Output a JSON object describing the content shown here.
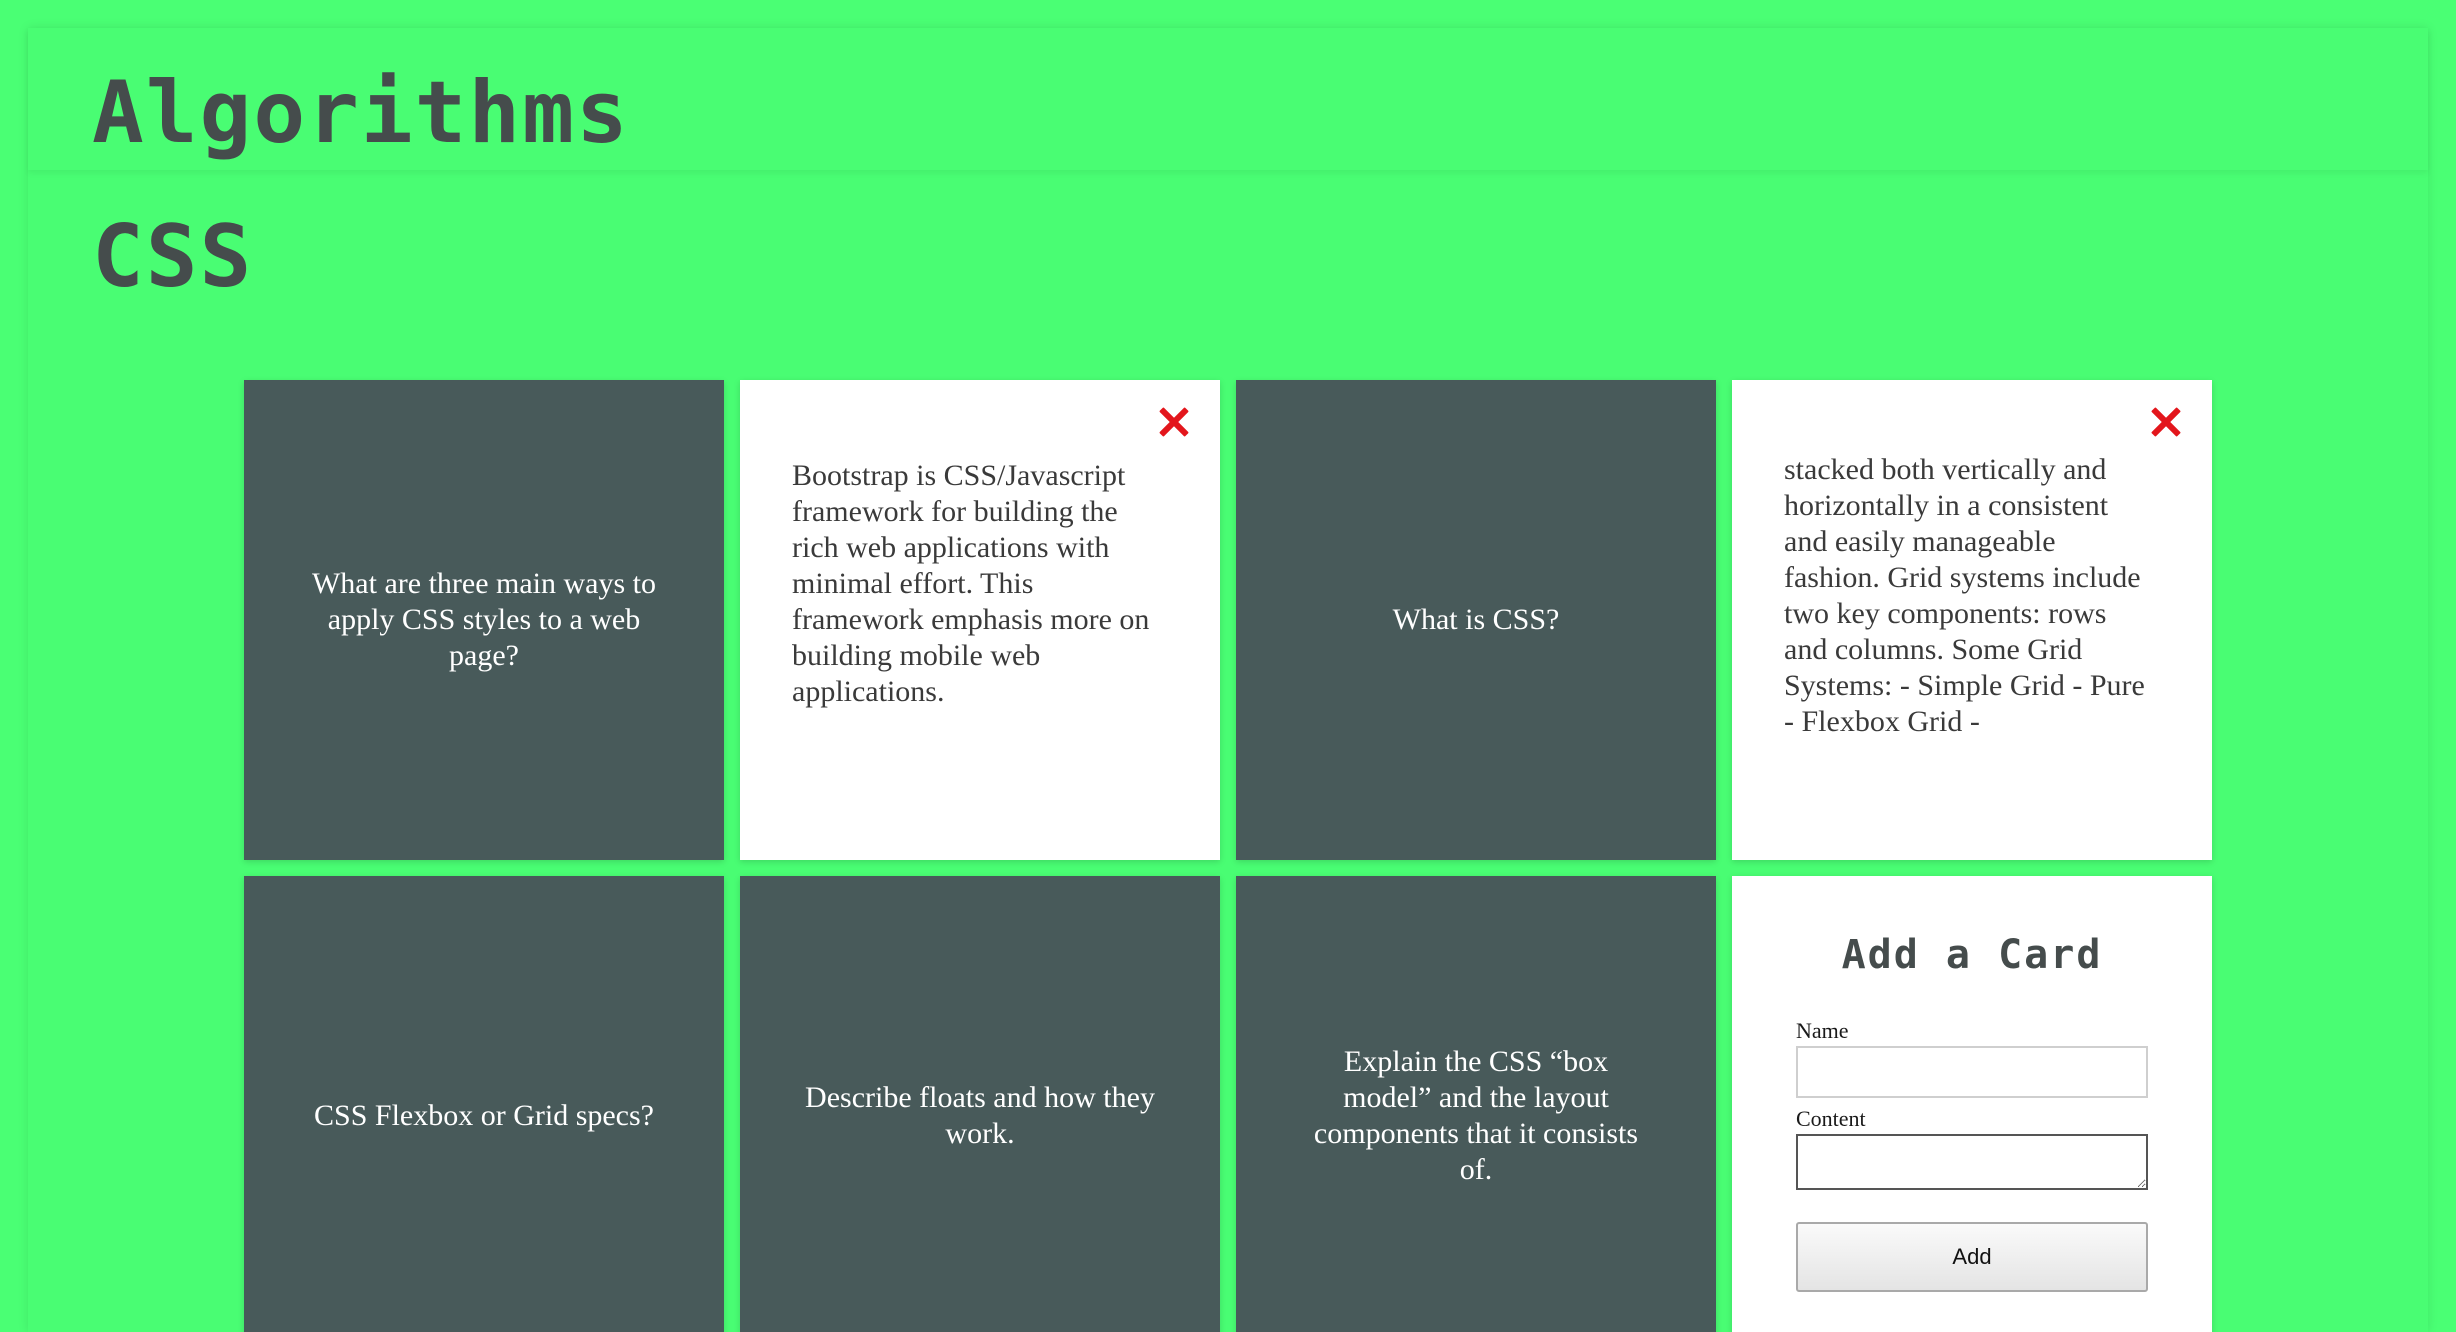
{
  "header": {
    "title": "Algorithms"
  },
  "section": {
    "title": "CSS"
  },
  "cards": [
    {
      "side": "front",
      "text": "What are three main ways to apply CSS styles to a web page?"
    },
    {
      "side": "back",
      "text": "Bootstrap is CSS/Javascript framework for building the rich web applications with minimal effort. This framework emphasis more on building mobile web applications."
    },
    {
      "side": "front",
      "text": "What is CSS?"
    },
    {
      "side": "back",
      "text": "stacked both vertically and horizontally in a consistent and easily manageable fashion. Grid systems include two key components: rows and columns. Some Grid Systems: - Simple Grid - Pure - Flexbox Grid -"
    },
    {
      "side": "front",
      "text": "CSS Flexbox or Grid specs?"
    },
    {
      "side": "front",
      "text": "Describe floats and how they work."
    },
    {
      "side": "front",
      "text": "Explain the CSS “box model” and the layout components that it consists of."
    }
  ],
  "add_form": {
    "title": "Add a Card",
    "name_label": "Name",
    "name_value": "",
    "content_label": "Content",
    "content_value": "",
    "button_label": "Add"
  },
  "colors": {
    "background": "#4aff74",
    "card_front": "#485a5a",
    "card_back": "#ffffff",
    "close_icon": "#e3161c",
    "heading_text": "#454c4c"
  },
  "icons": {
    "close": "close-x-icon"
  }
}
